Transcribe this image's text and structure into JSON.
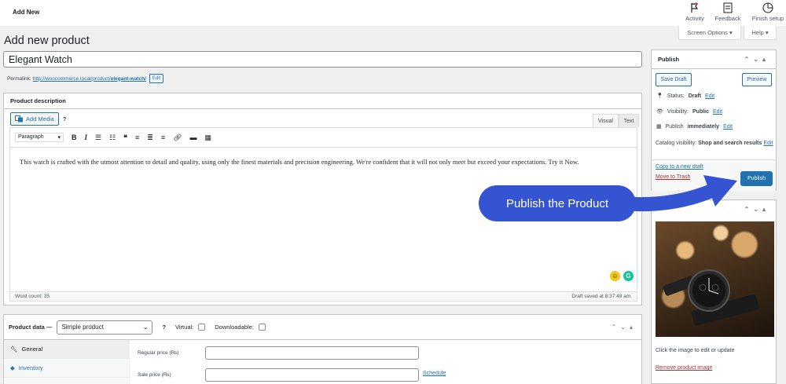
{
  "topbar": {
    "title": "Add New",
    "activity": "Activity",
    "feedback": "Feedback",
    "finish_setup": "Finish setup"
  },
  "screen_options": "Screen Options ▾",
  "help": "Help ▾",
  "page_title": "Add new product",
  "product_title": "Elegant Watch",
  "permalink": {
    "label": "Permalink:",
    "url_base": "http://woocommerce.local/product/",
    "slug": "elegant-watch/",
    "edit": "Edit"
  },
  "description": {
    "heading": "Product description",
    "add_media": "Add Media",
    "help": "?",
    "tab_visual": "Visual",
    "tab_text": "Text",
    "format": "Paragraph",
    "content": "This watch is crafted with the utmost attention to detail and quality, using only the finest materials and precision engineering. We're confident that it will not only meet but exceed your expectations.  Try it Now.",
    "word_count": "Word count: 35",
    "draft_saved": "Draft saved at 8:37:49 am."
  },
  "product_data": {
    "label": "Product data —",
    "type": "Simple product",
    "virtual": "Virtual:",
    "downloadable": "Downloadable:",
    "tabs": [
      "General",
      "Inventory"
    ],
    "regular_price_label": "Regular price (₨)",
    "sale_price_label": "Sale price (₨)",
    "schedule": "Schedule"
  },
  "publish": {
    "heading": "Publish",
    "save_draft": "Save Draft",
    "preview": "Preview",
    "status_label": "Status:",
    "status_value": "Draft",
    "visibility_label": "Visibility:",
    "visibility_value": "Public",
    "publish_label": "Publish",
    "publish_value": "immediately",
    "edit": "Edit",
    "catalog_label": "Catalog visibility:",
    "catalog_value": "Shop and search results",
    "copy_draft": "Copy to a new draft",
    "move_trash": "Move to Trash",
    "publish_button": "Publish"
  },
  "image_box": {
    "caption": "Click the image to edit or update",
    "remove": "Remove product image"
  },
  "callout": "Publish the Product",
  "colors": {
    "accent": "#2271b1",
    "callout": "#3454d1",
    "trash": "#b32d2e"
  }
}
